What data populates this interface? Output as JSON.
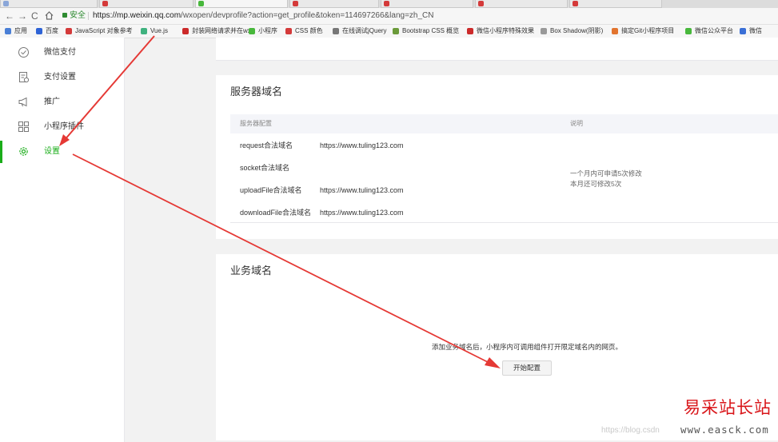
{
  "browser": {
    "address": {
      "secure_label": "安全",
      "url_host": "https://mp.weixin.qq.com",
      "url_path": "/wxopen/devprofile?action=get_profile&token=114697266&lang=zh_CN"
    },
    "bookmarks": [
      {
        "label": "应用",
        "icon": "apps-grid-icon",
        "color": "#4a7fd6"
      },
      {
        "label": "百度",
        "icon": "baidu-icon",
        "color": "#2e63d6"
      },
      {
        "label": "JavaScript 对象参考",
        "icon": "bookmark-icon",
        "color": "#d43a3a"
      },
      {
        "label": "Vue.js",
        "icon": "vue-icon",
        "color": "#3fb27f"
      },
      {
        "label": "封装网络请求并在wx",
        "icon": "bookmark-icon",
        "color": "#cc2a2a"
      },
      {
        "label": "小程序",
        "icon": "wechat-icon",
        "color": "#48b83c"
      },
      {
        "label": "CSS 颜色",
        "icon": "bookmark-icon",
        "color": "#d43a3a"
      },
      {
        "label": "在线调试jQuery",
        "icon": "bookmark-icon",
        "color": "#777777"
      },
      {
        "label": "Bootstrap CSS 概览",
        "icon": "bootstrap-icon",
        "color": "#6b9a3a"
      },
      {
        "label": "微信小程序特殊效果",
        "icon": "bookmark-icon",
        "color": "#cc2a2a"
      },
      {
        "label": "Box Shadow(阴影)",
        "icon": "page-icon",
        "color": "#999999"
      },
      {
        "label": "搞定Git小程序项目",
        "icon": "gitlab-icon",
        "color": "#e2742e"
      },
      {
        "label": "微信公众平台",
        "icon": "wechat-icon",
        "color": "#48b83c"
      },
      {
        "label": "微信",
        "icon": "bookmark-icon",
        "color": "#3a6fd6"
      }
    ]
  },
  "sidebar": {
    "items": [
      {
        "label": "微信支付",
        "icon": "wechat-pay-icon"
      },
      {
        "label": "支付设置",
        "icon": "payment-settings-icon"
      },
      {
        "label": "推广",
        "icon": "promotion-icon"
      },
      {
        "label": "小程序插件",
        "icon": "plugin-grid-icon"
      },
      {
        "label": "设置",
        "icon": "gear-icon",
        "active": true
      }
    ]
  },
  "server_domain": {
    "title": "服务器域名",
    "header": {
      "config": "服务器配置",
      "desc": "说明"
    },
    "rows": [
      {
        "label": "request合法域名",
        "value": "https://www.tuling123.com"
      },
      {
        "label": "socket合法域名",
        "value": ""
      },
      {
        "label": "uploadFile合法域名",
        "value": "https://www.tuling123.com"
      },
      {
        "label": "downloadFile合法域名",
        "value": "https://www.tuling123.com"
      }
    ],
    "note": [
      "一个月内可申请5次修改",
      "本月还可修改5次"
    ]
  },
  "business_domain": {
    "title": "业务域名",
    "description": "添加业务域名后，小程序内可调用组件打开限定域名内的网页。",
    "start_button": "开始配置"
  },
  "watermark": {
    "brand": "易采站长站",
    "csdn": "https://blog.csdn",
    "site": "www.easck.com"
  },
  "colors": {
    "accent": "#1aad19",
    "annotation_arrow": "#e53935",
    "watermark": "#d9161a"
  }
}
